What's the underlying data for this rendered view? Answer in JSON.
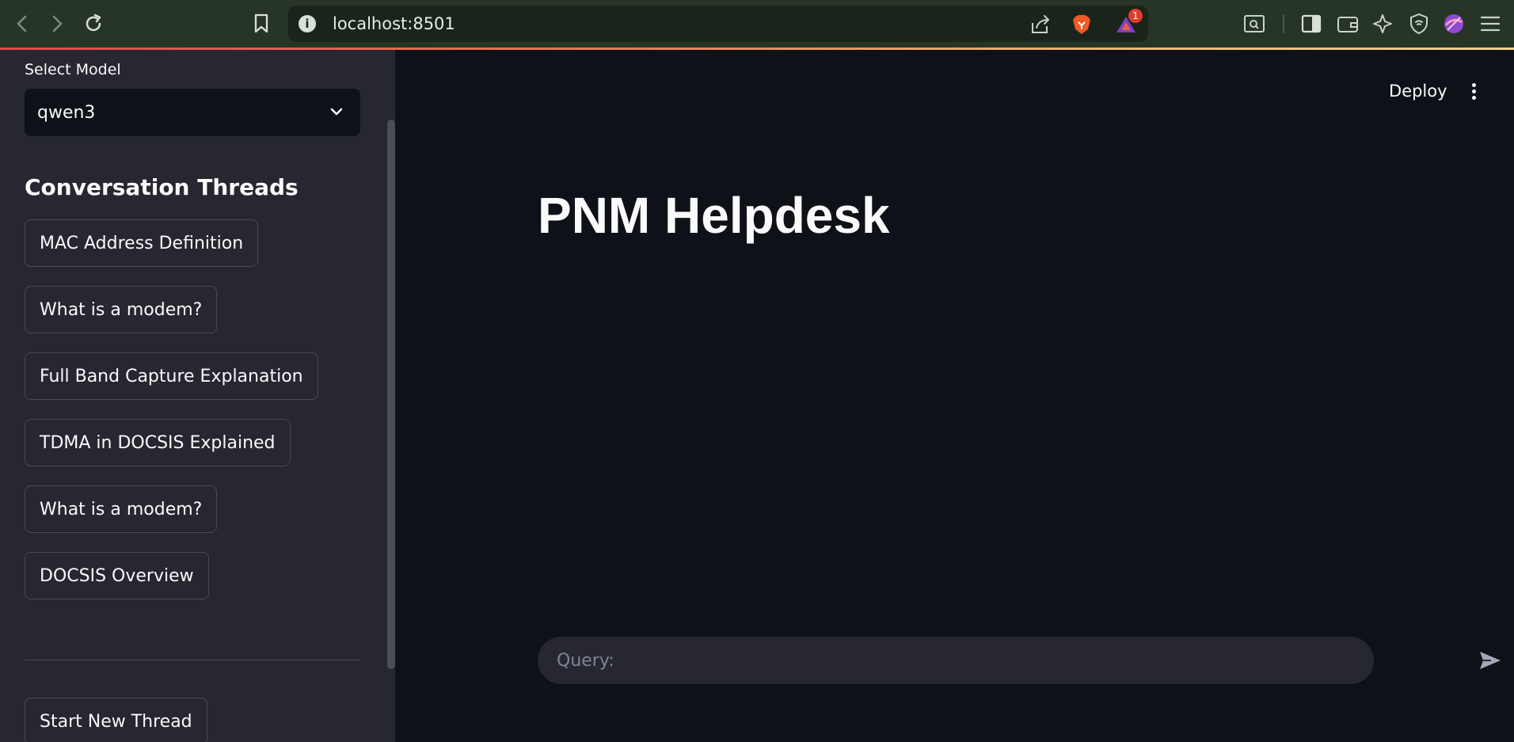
{
  "browser": {
    "url": "localhost:8501",
    "notification_count": "1"
  },
  "sidebar": {
    "model_label": "Select Model",
    "model_value": "qwen3",
    "section_title": "Conversation Threads",
    "threads": [
      "MAC Address Definition",
      "What is a modem?",
      "Full Band Capture Explanation",
      "TDMA in DOCSIS Explained",
      "What is a modem?",
      "DOCSIS Overview"
    ],
    "new_thread_label": "Start New Thread"
  },
  "header": {
    "deploy_label": "Deploy"
  },
  "main": {
    "title": "PNM Helpdesk",
    "query_placeholder": "Query:"
  }
}
